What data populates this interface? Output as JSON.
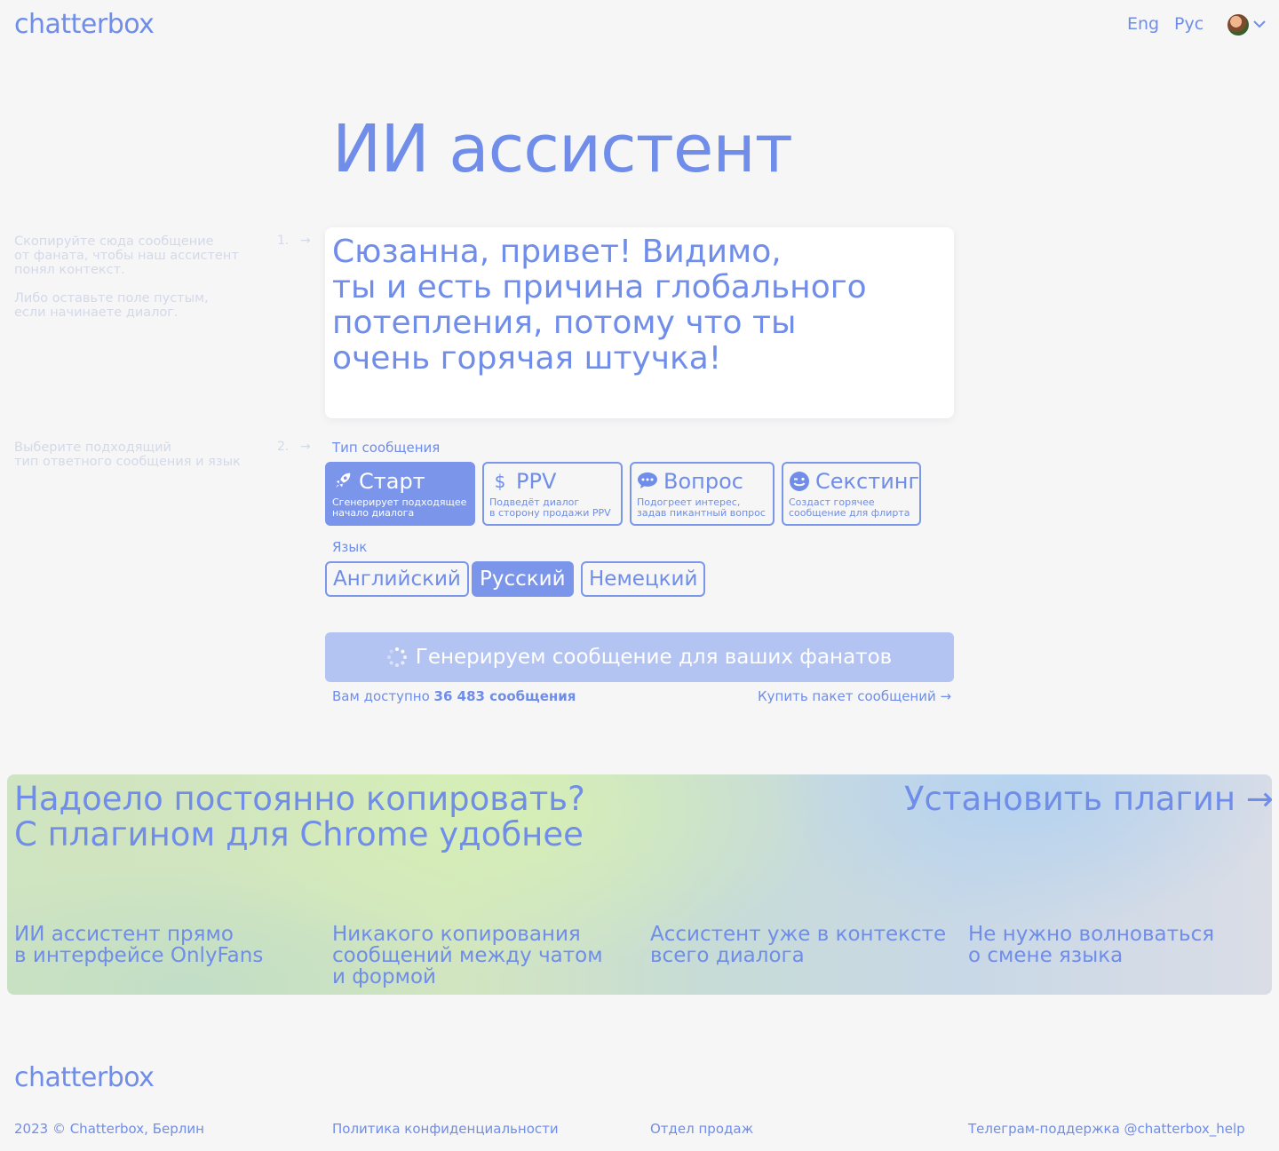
{
  "header": {
    "logo": "chatterbox",
    "lang_en": "Eng",
    "lang_ru": "Рус",
    "avatar_icon": "user-avatar",
    "menu_chevron": "⌵"
  },
  "hero": {
    "title": "ИИ ассистент"
  },
  "step1": {
    "number": "1.",
    "arrow": "→",
    "hint_line1": "Скопируйте сюда сообщение\nот фаната, чтобы наш ассистент\nпонял контекст.",
    "hint_line2": "Либо оставьте поле пустым,\nесли начинаете диалог.",
    "message": "Сюзанна, привет! Видимо,\nты и есть причина глобального\nпотепления, потому что ты\nочень горячая штучка!"
  },
  "step2": {
    "number": "2.",
    "arrow": "→",
    "hint": "Выберите подходящий\nтип ответного сообщения и язык",
    "type_label": "Тип сообщения",
    "types": [
      {
        "icon": "rocket-icon",
        "title": "Старт",
        "desc": "Сгенерирует подходящее\nначало диалога",
        "active": true
      },
      {
        "icon": "dollar-icon",
        "title": "PPV",
        "desc": "Подведёт диалог\nв сторону продажи PPV",
        "active": false
      },
      {
        "icon": "chat-bubble-icon",
        "title": "Вопрос",
        "desc": "Подогреет интерес,\nзадав пикантный вопрос",
        "active": false
      },
      {
        "icon": "wink-emoji-icon",
        "title": "Секстинг",
        "desc": "Создаст горячее\nсообщение для флирта",
        "active": false
      }
    ],
    "language_label": "Язык",
    "languages": [
      {
        "label": "Английский",
        "active": false
      },
      {
        "label": "Русский",
        "active": true
      },
      {
        "label": "Немецкий",
        "active": false
      }
    ]
  },
  "generate": {
    "button_label": "Генерируем сообщение для ваших фанатов",
    "available_prefix": "Вам доступно ",
    "available_count": "36 483 сообщения",
    "buy_link": "Купить пакет сообщений →"
  },
  "banner": {
    "title": "Надоело постоянно копировать?\nС плагином для Chrome удобнее",
    "cta": "Установить плагин →",
    "features": [
      "ИИ ассистент прямо\nв интерфейсе OnlyFans",
      "Никакого копирования\nсообщений между чатом\nи формой",
      "Ассистент уже в контексте\nвсего диалога",
      "Не нужно волноваться\nо смене языка"
    ]
  },
  "footer": {
    "logo": "chatterbox",
    "copyright": "2023 © Chatterbox, Берлин",
    "privacy": "Политика конфиденциальности",
    "sales": "Отдел продаж",
    "support": "Телеграм-поддержка @chatterbox_help"
  },
  "colors": {
    "accent": "#6f8de9",
    "accent_fill": "#7a95ea",
    "button_disabled": "#b4c4f2",
    "hint_text": "#d4d9e8",
    "background": "#f6f6f7"
  }
}
